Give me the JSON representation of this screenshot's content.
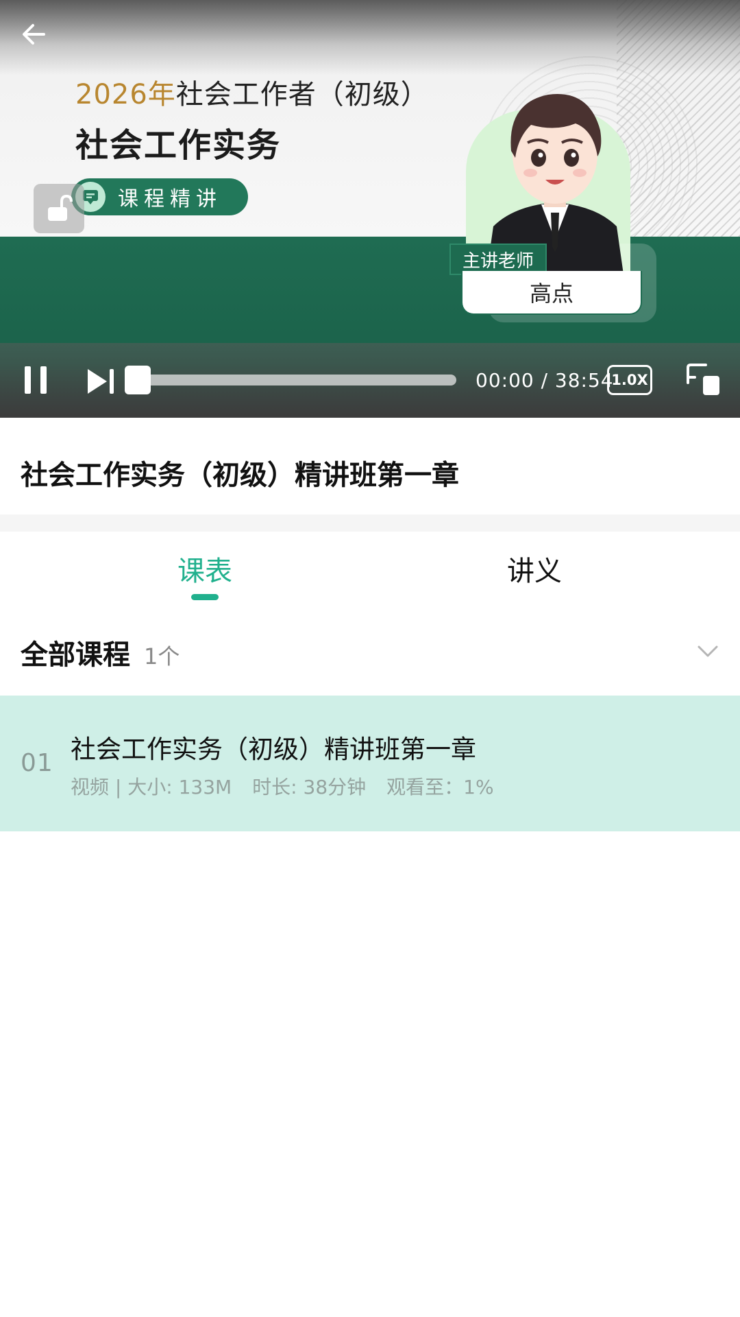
{
  "player": {
    "slide": {
      "year": "2026年",
      "headline_rest": "社会工作者（初级）",
      "title": "社会工作实务",
      "badge": "课程精讲",
      "teacher_tag": "主讲老师",
      "teacher_name": "高点"
    },
    "time_display": "00:00 / 38:54",
    "speed": "1.0X",
    "progress_fraction": 0.0
  },
  "course": {
    "title": "社会工作实务（初级）精讲班第一章"
  },
  "tabs": [
    {
      "label": "课表",
      "active": true
    },
    {
      "label": "讲义",
      "active": false
    }
  ],
  "section": {
    "title": "全部课程",
    "count": "1个"
  },
  "lessons": [
    {
      "index": "01",
      "title": "社会工作实务（初级）精讲班第一章",
      "type_size": "视频 | 大小: 133M",
      "duration": "时长: 38分钟",
      "watched": "观看至：1%"
    }
  ],
  "colors": {
    "accent": "#20b08d",
    "lesson_highlight": "#cfefe7",
    "slide_green": "#1f6c52",
    "year_gold": "#b8862f"
  },
  "icons": [
    "back-arrow-icon",
    "lock-open-icon",
    "pause-icon",
    "next-icon",
    "pip-icon",
    "chevron-down-icon"
  ]
}
